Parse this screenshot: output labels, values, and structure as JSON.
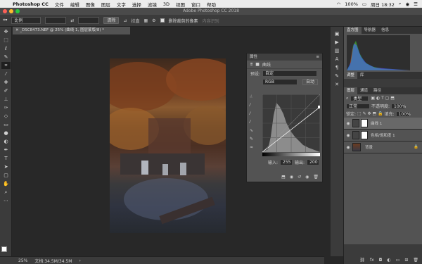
{
  "menubar": {
    "app": "Photoshop CC",
    "items": [
      "文件",
      "编辑",
      "图像",
      "图层",
      "文字",
      "选择",
      "滤镜",
      "3D",
      "视图",
      "窗口",
      "帮助"
    ],
    "battery": "100%",
    "clock": "周日 18:32"
  },
  "window_title": "Adobe Photoshop CC 2018",
  "options": {
    "ratio": "比例",
    "clear": "清除",
    "straighten": "拉直",
    "delete_cropped": "删除裁剪的像素",
    "content_aware": "内容识别"
  },
  "doc_tab": "_DSC8473.NEF @ 25% (曲线 1, 图层蒙版/8) *",
  "status": {
    "zoom": "25%",
    "docsize": "文档:34.5M/34.5M"
  },
  "properties": {
    "title": "属性",
    "panel_name": "曲线",
    "preset_label": "预设:",
    "preset_value": "自定",
    "channel": "RGB",
    "auto": "自动",
    "input_label": "输入:",
    "input_value": "255",
    "output_label": "输出:",
    "output_value": "200"
  },
  "histogram_tabs": [
    "直方图",
    "导航器",
    "信息"
  ],
  "adjust_tabs": [
    "调整",
    "库"
  ],
  "layers_tabs": [
    "图层",
    "通道",
    "路径"
  ],
  "layers": {
    "kind": "类型",
    "blend": "正常",
    "opacity_label": "不透明度:",
    "opacity_value": "100%",
    "lock_label": "锁定:",
    "fill_label": "填充:",
    "fill_value": "100%",
    "items": [
      "曲线 1",
      "色相/饱和度 1",
      "背景"
    ]
  }
}
